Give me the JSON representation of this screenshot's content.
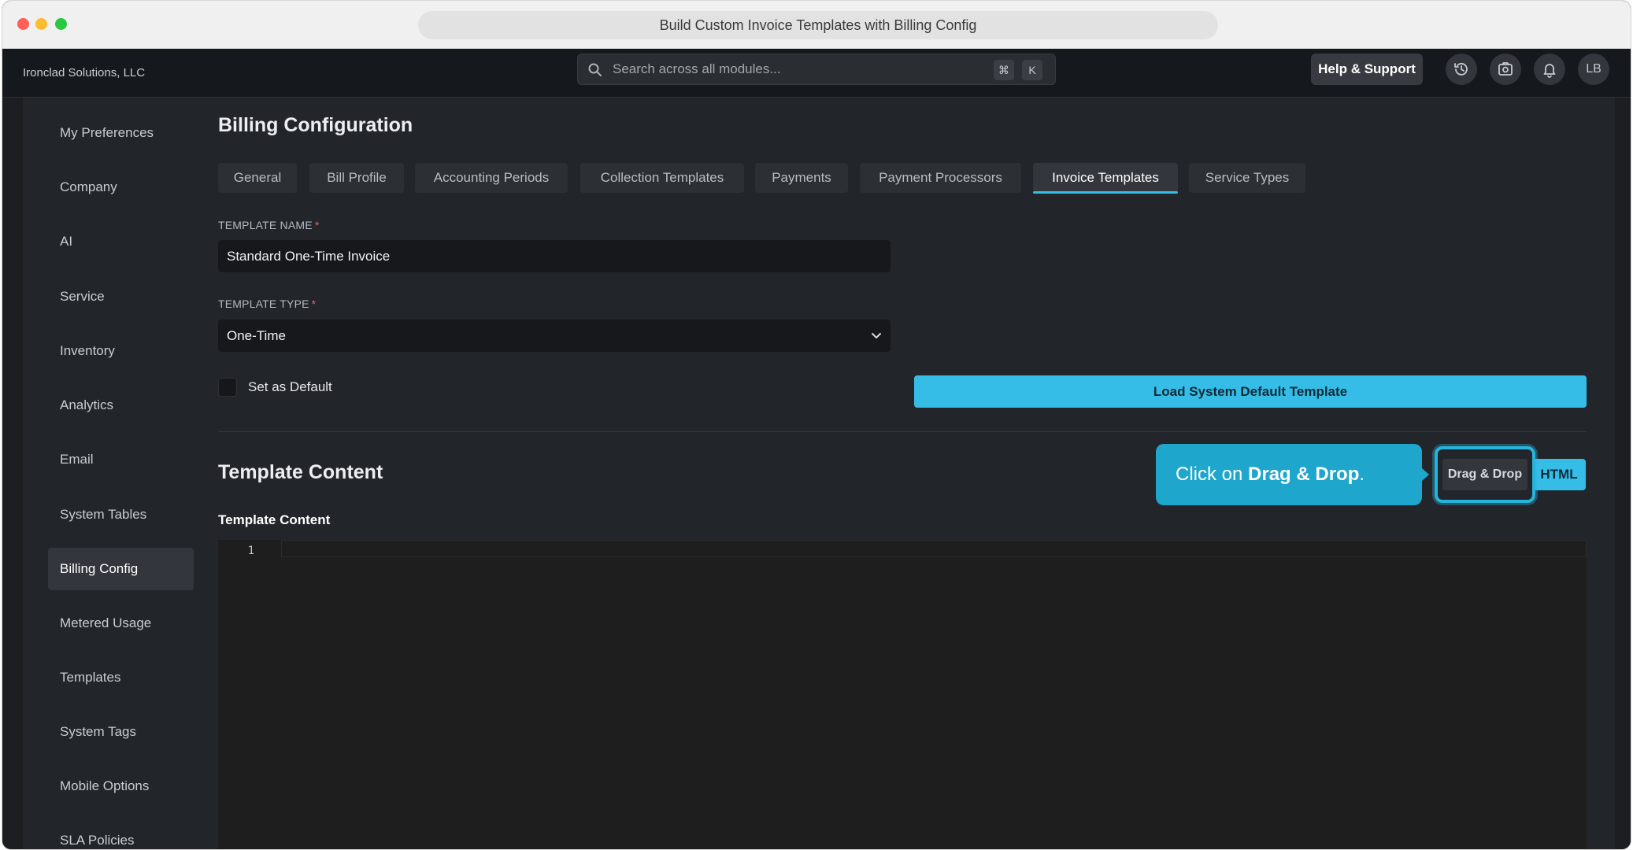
{
  "browser": {
    "tab_title": "Build Custom Invoice Templates with Billing Config"
  },
  "header": {
    "company": "Ironclad Solutions, LLC",
    "search_placeholder": "Search across all modules...",
    "shortcut_keys": [
      "⌘",
      "K"
    ],
    "help_label": "Help & Support",
    "icons": [
      "history-icon",
      "screenshot-icon",
      "bell-icon"
    ],
    "avatar_initials": "LB"
  },
  "sidebar": {
    "items": [
      {
        "label": "My Preferences"
      },
      {
        "label": "Company"
      },
      {
        "label": "AI"
      },
      {
        "label": "Service"
      },
      {
        "label": "Inventory"
      },
      {
        "label": "Analytics"
      },
      {
        "label": "Email"
      },
      {
        "label": "System Tables"
      },
      {
        "label": "Billing Config",
        "active": true
      },
      {
        "label": "Metered Usage"
      },
      {
        "label": "Templates"
      },
      {
        "label": "System Tags"
      },
      {
        "label": "Mobile Options"
      },
      {
        "label": "SLA Policies"
      }
    ]
  },
  "main": {
    "title": "Billing Configuration",
    "tabs": [
      {
        "label": "General"
      },
      {
        "label": "Bill Profile"
      },
      {
        "label": "Accounting Periods"
      },
      {
        "label": "Collection Templates"
      },
      {
        "label": "Payments"
      },
      {
        "label": "Payment Processors"
      },
      {
        "label": "Invoice Templates",
        "active": true
      },
      {
        "label": "Service Types"
      }
    ],
    "template_name": {
      "label": "TEMPLATE NAME",
      "required_mark": "*",
      "value": "Standard One-Time Invoice"
    },
    "template_type": {
      "label": "TEMPLATE TYPE",
      "required_mark": "*",
      "value": "One-Time"
    },
    "set_default_label": "Set as Default",
    "set_default_checked": false,
    "load_default_button": "Load System Default Template",
    "section_title": "Template Content",
    "tooltip": {
      "prefix": "Click on ",
      "bold": "Drag & Drop",
      "suffix": "."
    },
    "mode_buttons": {
      "drag_drop": "Drag & Drop",
      "html": "HTML"
    },
    "content_label": "Template Content",
    "editor": {
      "line_numbers": [
        "1"
      ],
      "content": ""
    }
  },
  "colors": {
    "accent": "#35bde8",
    "tooltip": "#1fa6cc",
    "required": "#ff5a5f",
    "background": "#22252a"
  }
}
